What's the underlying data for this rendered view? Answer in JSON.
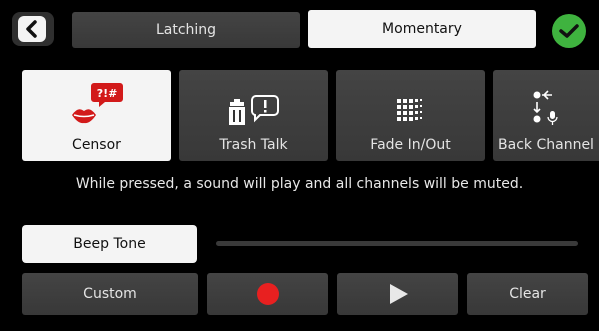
{
  "modes": {
    "latching": "Latching",
    "momentary": "Momentary"
  },
  "effects": [
    {
      "label": "Censor",
      "icon": "censor-icon",
      "selected": true
    },
    {
      "label": "Trash Talk",
      "icon": "trash-talk-icon",
      "selected": false
    },
    {
      "label": "Fade In/Out",
      "icon": "fade-icon",
      "selected": false
    },
    {
      "label": "Back Channel",
      "icon": "back-channel-icon",
      "selected": false
    }
  ],
  "description": "While pressed, a sound will play and all channels will be muted.",
  "sound": {
    "selected": "Beep Tone"
  },
  "controls": {
    "custom": "Custom",
    "clear": "Clear"
  },
  "colors": {
    "accent_green": "#3fb33f",
    "record_red": "#e82020",
    "censor_red": "#d21a1a"
  }
}
